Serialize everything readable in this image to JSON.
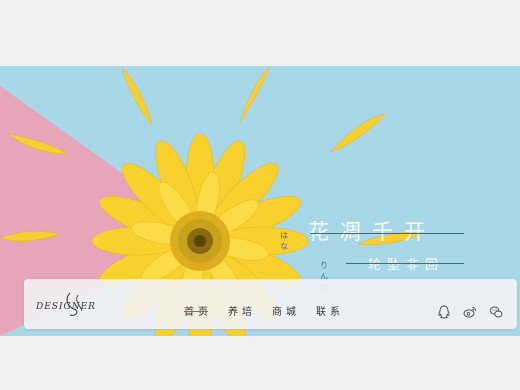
{
  "banner": {
    "kana_top": "はな",
    "title_top": "花凋千开",
    "kana_bottom": "りんね",
    "title_bottom": "轮坠非回",
    "colors": {
      "sky": "#a8d7e8",
      "pink": "#e6a5b8",
      "petal": "#f7cf32",
      "flower_center": "#c9a21b",
      "ink": "#2e6f96"
    }
  },
  "header": {
    "logo_text": "DESIGNER",
    "nav": [
      {
        "label": "首页",
        "active": true
      },
      {
        "label": "养培",
        "active": false
      },
      {
        "label": "商城",
        "active": false
      },
      {
        "label": "联系",
        "active": false
      }
    ],
    "social_icons": [
      "qq-icon",
      "weibo-icon",
      "wechat-icon"
    ]
  }
}
